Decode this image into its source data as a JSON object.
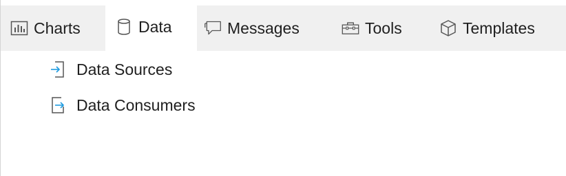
{
  "tabs": [
    {
      "label": "Charts",
      "icon": "bar-chart-icon"
    },
    {
      "label": "Data",
      "icon": "database-icon",
      "active": true
    },
    {
      "label": "Messages",
      "icon": "speech-bubble-icon"
    },
    {
      "label": "Tools",
      "icon": "toolbox-icon"
    },
    {
      "label": "Templates",
      "icon": "cube-icon"
    }
  ],
  "data_panel": {
    "items": [
      {
        "label": "Data Sources",
        "icon": "import-arrow-icon"
      },
      {
        "label": "Data Consumers",
        "icon": "export-arrow-icon"
      }
    ]
  },
  "colors": {
    "tabbar_bg": "#f0f0f0",
    "active_tab_bg": "#ffffff",
    "icon_gray": "#555555",
    "arrow_blue": "#1e9be0"
  }
}
